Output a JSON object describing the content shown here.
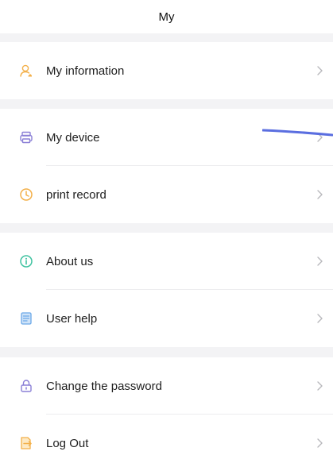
{
  "header": {
    "title": "My"
  },
  "sections": [
    {
      "items": [
        {
          "label": "My information",
          "icon": "user-icon"
        }
      ]
    },
    {
      "items": [
        {
          "label": "My device",
          "icon": "printer-icon"
        },
        {
          "label": "print record",
          "icon": "clock-icon"
        }
      ]
    },
    {
      "items": [
        {
          "label": "About us",
          "icon": "info-icon"
        },
        {
          "label": "User help",
          "icon": "document-icon"
        }
      ]
    },
    {
      "items": [
        {
          "label": "Change the password",
          "icon": "lock-icon"
        },
        {
          "label": "Log Out",
          "icon": "logout-icon"
        }
      ]
    }
  ],
  "colors": {
    "icon_orange": "#f3b04a",
    "icon_purple": "#8a7fd6",
    "icon_green": "#3fc2a0",
    "icon_blue": "#6aa8e8",
    "chevron": "#b8b8bc",
    "separator_bg": "#f3f3f5",
    "annotation_stroke": "#5a6ee0"
  }
}
